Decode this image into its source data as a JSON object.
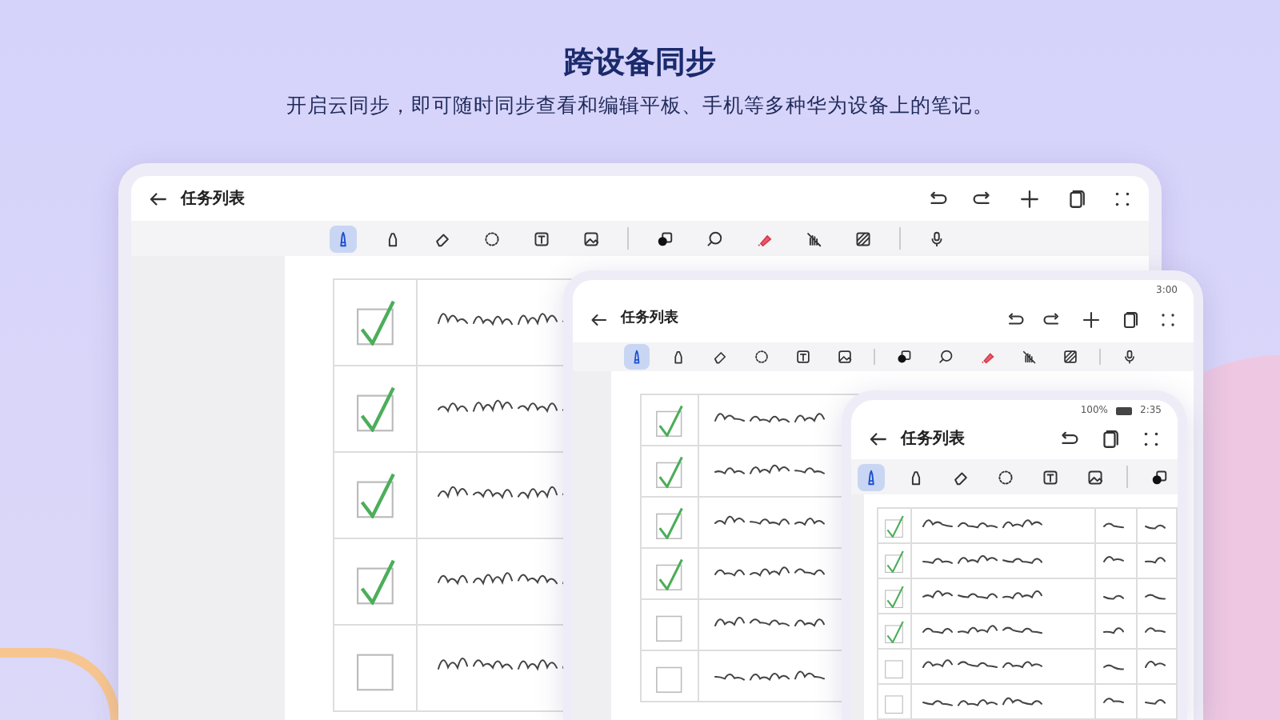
{
  "header": {
    "title": "跨设备同步",
    "subtitle": "开启云同步，即可随时同步查看和编辑平板、手机等多种华为设备上的笔记。"
  },
  "devices": [
    {
      "kind": "tablet",
      "title": "任务列表",
      "actions": [
        {
          "kind": "undo"
        },
        {
          "kind": "redo"
        },
        {
          "kind": "add"
        },
        {
          "kind": "pages"
        },
        {
          "kind": "more"
        }
      ],
      "tools": [
        {
          "kind": "pen",
          "selected": true
        },
        {
          "kind": "marker",
          "selected": false
        },
        {
          "kind": "eraser",
          "selected": false
        },
        {
          "kind": "lasso",
          "selected": false
        },
        {
          "kind": "text",
          "selected": false
        },
        {
          "kind": "image",
          "selected": false
        },
        {
          "kind": "sep"
        },
        {
          "kind": "color",
          "selected": false
        },
        {
          "kind": "zoom",
          "selected": false
        },
        {
          "kind": "highlighter",
          "selected": false
        },
        {
          "kind": "handoff",
          "selected": false
        },
        {
          "kind": "pattern",
          "selected": false
        },
        {
          "kind": "sep"
        },
        {
          "kind": "mic",
          "selected": false
        }
      ],
      "tasks": [
        {
          "checked": true
        },
        {
          "checked": true
        },
        {
          "checked": true
        },
        {
          "checked": true
        },
        {
          "checked": false
        }
      ]
    },
    {
      "kind": "foldable",
      "title": "任务列表",
      "status": {
        "time": "3:00"
      },
      "actions": [
        {
          "kind": "undo"
        },
        {
          "kind": "redo"
        },
        {
          "kind": "add"
        },
        {
          "kind": "pages"
        },
        {
          "kind": "more"
        }
      ],
      "tools": [
        {
          "kind": "pen",
          "selected": true
        },
        {
          "kind": "marker",
          "selected": false
        },
        {
          "kind": "eraser",
          "selected": false
        },
        {
          "kind": "lasso",
          "selected": false
        },
        {
          "kind": "text",
          "selected": false
        },
        {
          "kind": "image",
          "selected": false
        },
        {
          "kind": "sep"
        },
        {
          "kind": "color",
          "selected": false
        },
        {
          "kind": "zoom",
          "selected": false
        },
        {
          "kind": "highlighter",
          "selected": false
        },
        {
          "kind": "handoff",
          "selected": false
        },
        {
          "kind": "pattern",
          "selected": false
        },
        {
          "kind": "sep"
        },
        {
          "kind": "mic",
          "selected": false
        }
      ],
      "tasks": [
        {
          "checked": true
        },
        {
          "checked": true
        },
        {
          "checked": true
        },
        {
          "checked": true
        },
        {
          "checked": false
        },
        {
          "checked": false
        }
      ]
    },
    {
      "kind": "phone",
      "title": "任务列表",
      "status": {
        "battery": "100%",
        "time": "2:35"
      },
      "actions": [
        {
          "kind": "undo"
        },
        {
          "kind": "pages"
        },
        {
          "kind": "more"
        }
      ],
      "tools": [
        {
          "kind": "pen",
          "selected": true
        },
        {
          "kind": "marker",
          "selected": false
        },
        {
          "kind": "eraser",
          "selected": false
        },
        {
          "kind": "lasso",
          "selected": false
        },
        {
          "kind": "text",
          "selected": false
        },
        {
          "kind": "image",
          "selected": false
        },
        {
          "kind": "sep"
        },
        {
          "kind": "color",
          "selected": false
        }
      ],
      "tasks": [
        {
          "checked": true
        },
        {
          "checked": true
        },
        {
          "checked": true
        },
        {
          "checked": true
        },
        {
          "checked": false
        },
        {
          "checked": false
        }
      ]
    }
  ]
}
